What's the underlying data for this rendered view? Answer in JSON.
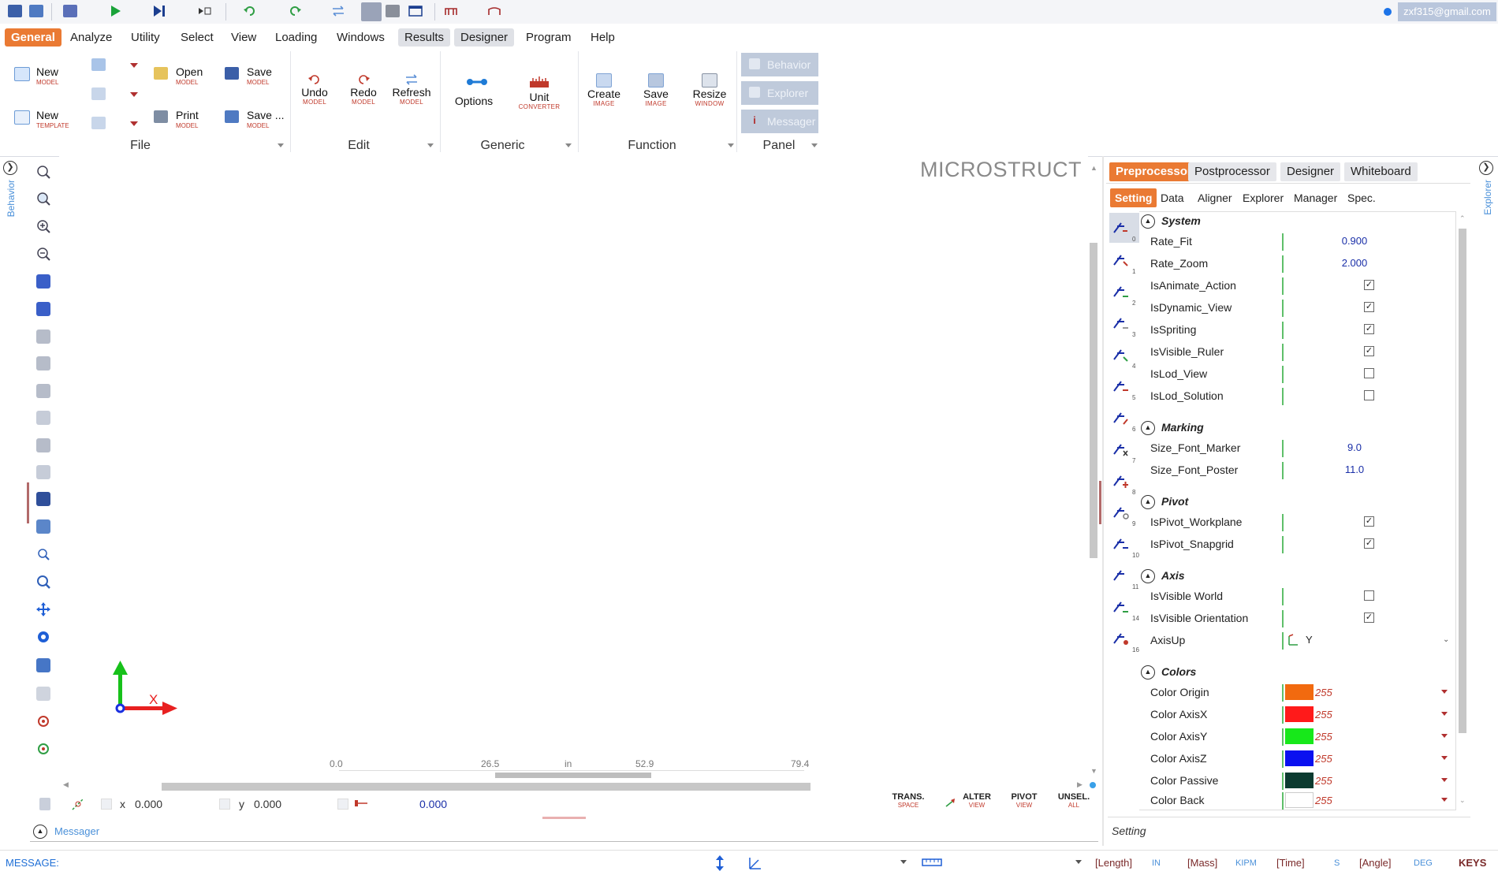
{
  "colors": {
    "accent": "#ea7a33",
    "value_blue": "#1a2fa8",
    "link_blue": "#4a90d9"
  },
  "user": {
    "email": "zxf315@gmail.com"
  },
  "menu": {
    "items": [
      "General",
      "Analyze",
      "Utility",
      "Select",
      "View",
      "Loading",
      "Windows",
      "Results",
      "Designer",
      "Program",
      "Help"
    ],
    "active": "General"
  },
  "ribbon": {
    "file": {
      "label": "File",
      "new_model": {
        "label": "New",
        "sub": "MODEL"
      },
      "new_template": {
        "label": "New",
        "sub": "TEMPLATE"
      },
      "open": {
        "label": "Open",
        "sub": "MODEL"
      },
      "print": {
        "label": "Print",
        "sub": "MODEL"
      },
      "save": {
        "label": "Save",
        "sub": "MODEL"
      },
      "save_as": {
        "label": "Save ...",
        "sub": "MODEL"
      }
    },
    "edit": {
      "label": "Edit",
      "undo": {
        "label": "Undo",
        "sub": "MODEL"
      },
      "redo": {
        "label": "Redo",
        "sub": "MODEL"
      },
      "refresh": {
        "label": "Refresh",
        "sub": "MODEL"
      }
    },
    "generic": {
      "label": "Generic",
      "options": {
        "label": "Options"
      },
      "unit": {
        "label": "Unit",
        "sub": "CONVERTER"
      }
    },
    "function": {
      "label": "Function",
      "create": {
        "label": "Create",
        "sub": "IMAGE"
      },
      "save": {
        "label": "Save",
        "sub": "IMAGE"
      },
      "resize": {
        "label": "Resize",
        "sub": "WINDOW"
      }
    },
    "panel": {
      "label": "Panel",
      "behavior": "Behavior",
      "explorer": "Explorer",
      "messager": "Messager"
    }
  },
  "left_side": {
    "behavior_label": "Behavior"
  },
  "right_side": {
    "explorer_label": "Explorer"
  },
  "canvas": {
    "title": "MICROSTRUCT",
    "axis_x_label": "X",
    "ruler": {
      "ticks": [
        "0.0",
        "26.5",
        "52.9",
        "79.4"
      ],
      "unit": "in"
    }
  },
  "coords": {
    "x_label": "x",
    "x_value": "0.000",
    "y_label": "y",
    "y_value": "0.000",
    "dist_value": "0.000"
  },
  "modes": [
    {
      "label": "TRANS.",
      "sub": "SPACE"
    },
    {
      "label": "ALTER",
      "sub": "VIEW"
    },
    {
      "label": "PIVOT",
      "sub": "VIEW"
    },
    {
      "label": "UNSEL.",
      "sub": "ALL"
    }
  ],
  "messager": {
    "label": "Messager"
  },
  "status": {
    "message_label": "MESSAGE:",
    "length_label": "[Length]",
    "length_unit": "IN",
    "mass_label": "[Mass]",
    "mass_unit": "KIPM",
    "time_label": "[Time]",
    "time_unit": "S",
    "angle_label": "[Angle]",
    "angle_unit": "DEG",
    "keys_label": "KEYS"
  },
  "panel_tabs": {
    "items": [
      "Preprocessor",
      "Postprocessor",
      "Designer",
      "Whiteboard"
    ],
    "active": "Preprocessor"
  },
  "sub_tabs": {
    "items": [
      "Setting",
      "Data",
      "Aligner",
      "Explorer",
      "Manager",
      "Spec."
    ],
    "active": "Setting"
  },
  "strip_numbers": [
    "0",
    "1",
    "2",
    "3",
    "4",
    "5",
    "6",
    "7",
    "8",
    "9",
    "10",
    "11",
    "14",
    "16"
  ],
  "properties": {
    "system": {
      "title": "System",
      "rate_fit": {
        "name": "Rate_Fit",
        "value": "0.900"
      },
      "rate_zoom": {
        "name": "Rate_Zoom",
        "value": "2.000"
      },
      "is_animate_action": {
        "name": "IsAnimate_Action",
        "checked": true
      },
      "is_dynamic_view": {
        "name": "IsDynamic_View",
        "checked": true
      },
      "is_spriting": {
        "name": "IsSpriting",
        "checked": true
      },
      "is_visible_ruler": {
        "name": "IsVisible_Ruler",
        "checked": true
      },
      "is_lod_view": {
        "name": "IsLod_View",
        "checked": false
      },
      "is_lod_solution": {
        "name": "IsLod_Solution",
        "checked": false
      }
    },
    "marking": {
      "title": "Marking",
      "size_font_marker": {
        "name": "Size_Font_Marker",
        "value": "9.0"
      },
      "size_font_poster": {
        "name": "Size_Font_Poster",
        "value": "11.0"
      }
    },
    "pivot": {
      "title": "Pivot",
      "is_pivot_workplane": {
        "name": "IsPivot_Workplane",
        "checked": true
      },
      "is_pivot_snapgrid": {
        "name": "IsPivot_Snapgrid",
        "checked": true
      }
    },
    "axis": {
      "title": "Axis",
      "is_visible_world": {
        "name": "IsVisible World",
        "checked": false
      },
      "is_visible_orientation": {
        "name": "IsVisible Orientation",
        "checked": true
      },
      "axis_up": {
        "name": "AxisUp",
        "value": "Y"
      }
    },
    "colors": {
      "title": "Colors",
      "color_origin": {
        "name": "Color Origin",
        "color": "#f26a0f",
        "value": "255"
      },
      "color_axis_x": {
        "name": "Color AxisX",
        "color": "#ff1a1a",
        "value": "255"
      },
      "color_axis_y": {
        "name": "Color AxisY",
        "color": "#17e81a",
        "value": "255"
      },
      "color_axis_z": {
        "name": "Color AxisZ",
        "color": "#0a10f0",
        "value": "255"
      },
      "color_passive": {
        "name": "Color Passive",
        "color": "#0c3b30",
        "value": "255"
      },
      "color_back": {
        "name": "Color Back",
        "color": "#ffffff",
        "value": "255"
      }
    }
  },
  "setting_footer": "Setting"
}
